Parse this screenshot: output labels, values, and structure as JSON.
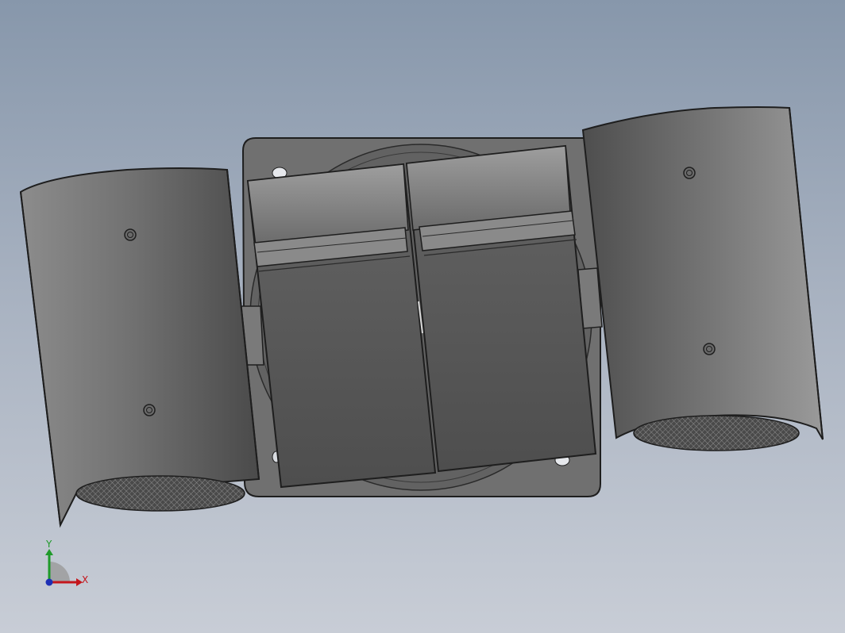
{
  "viewport": {
    "background_top": "#8797ab",
    "background_bottom": "#c8cdd6"
  },
  "model": {
    "body_color": "#6e6e6e",
    "edge_color": "#1e1e1e"
  },
  "triad": {
    "x_label": "X",
    "y_label": "Y",
    "x_color": "#c4161c",
    "y_color": "#1f9a2a",
    "z_color": "#1d2fb5"
  }
}
